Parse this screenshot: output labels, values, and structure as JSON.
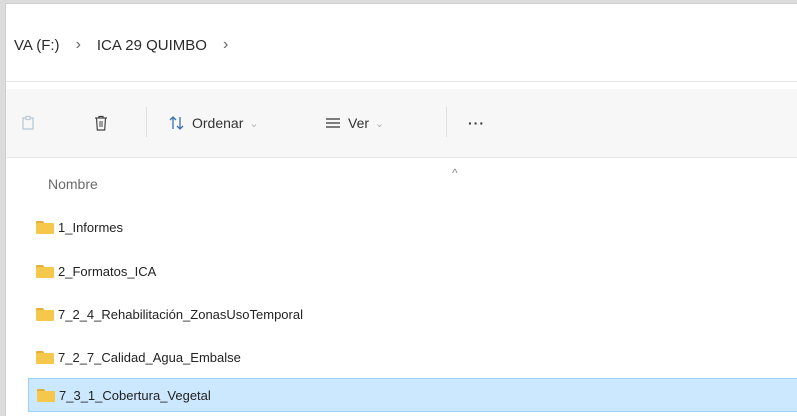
{
  "breadcrumb": {
    "items": [
      "VA (F:)",
      "ICA 29 QUIMBO"
    ],
    "separator": "›"
  },
  "toolbar": {
    "sort_label": "Ordenar",
    "view_label": "Ver",
    "more_label": "···",
    "caret": "⌄"
  },
  "list": {
    "column_name": "Nombre",
    "sort_indicator": "^",
    "items": [
      {
        "name": "1_Informes",
        "selected": false
      },
      {
        "name": "2_Formatos_ICA",
        "selected": false
      },
      {
        "name": "7_2_4_Rehabilitación_ZonasUsoTemporal",
        "selected": false
      },
      {
        "name": "7_2_7_Calidad_Agua_Embalse",
        "selected": false
      },
      {
        "name": "7_3_1_Cobertura_Vegetal",
        "selected": true
      }
    ]
  },
  "colors": {
    "folder": "#f5c74a",
    "selection_bg": "#cce8ff",
    "selection_border": "#99d1ff"
  },
  "icons": [
    "paste-icon",
    "delete-icon",
    "sort-icon",
    "view-icon",
    "more-icon",
    "folder-icon",
    "chevron-right-icon"
  ]
}
